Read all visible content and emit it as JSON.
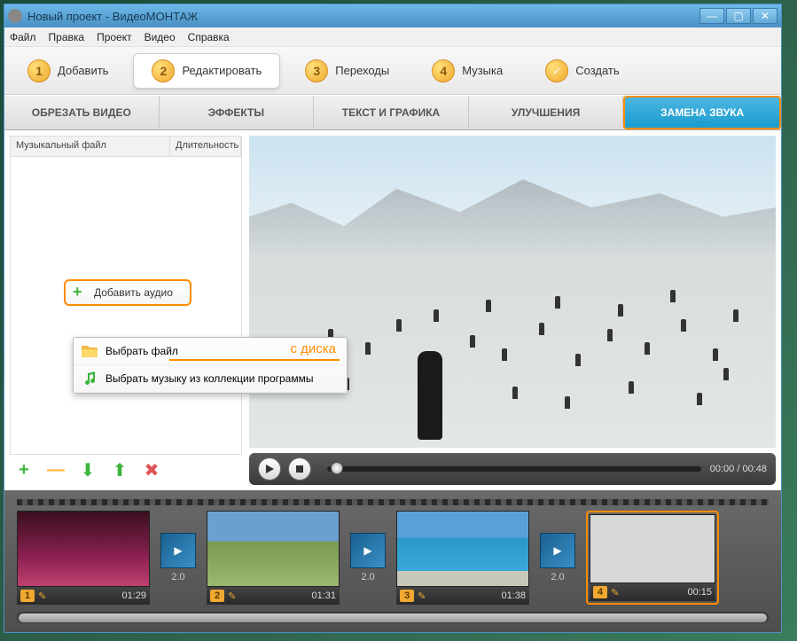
{
  "window": {
    "title": "Новый проект - ВидеоМОНТАЖ"
  },
  "menu": {
    "file": "Файл",
    "edit": "Правка",
    "project": "Проект",
    "video": "Видео",
    "help": "Справка"
  },
  "steps": {
    "add": "Добавить",
    "edit": "Редактировать",
    "transitions": "Переходы",
    "music": "Музыка",
    "create": "Создать"
  },
  "subtabs": {
    "crop": "ОБРЕЗАТЬ ВИДЕО",
    "effects": "ЭФФЕКТЫ",
    "text": "ТЕКСТ И ГРАФИКА",
    "enhance": "УЛУЧШЕНИЯ",
    "audio": "ЗАМЕНА ЗВУКА"
  },
  "audio_panel": {
    "col_file": "Музыкальный файл",
    "col_dur": "Длительность",
    "add_btn": "Добавить аудио"
  },
  "context": {
    "choose_file": "Выбрать файл",
    "annotation": "с диска",
    "choose_lib": "Выбрать музыку из коллекции программы"
  },
  "player": {
    "time_cur": "00:00",
    "time_sep": " / ",
    "time_total": "00:48"
  },
  "timeline": {
    "clips": [
      {
        "idx": "1",
        "dur": "01:29"
      },
      {
        "idx": "2",
        "dur": "01:31"
      },
      {
        "idx": "3",
        "dur": "01:38"
      },
      {
        "idx": "4",
        "dur": "00:15"
      }
    ],
    "trans_dur": "2.0"
  }
}
